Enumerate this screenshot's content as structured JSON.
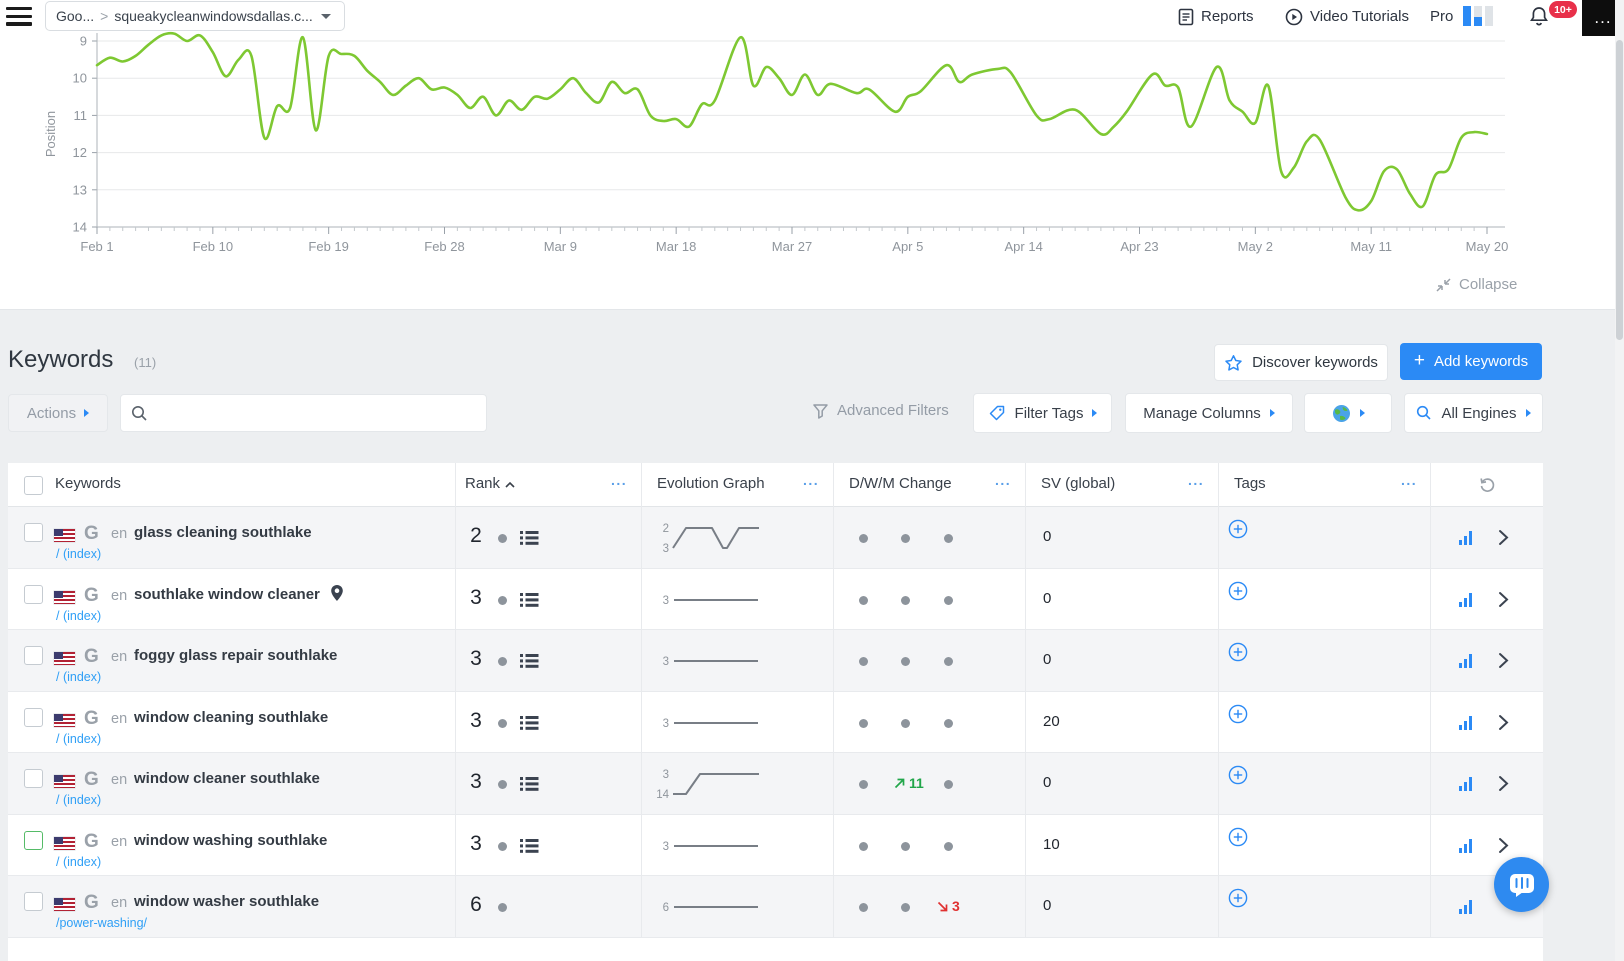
{
  "topbar": {
    "breadcrumb": {
      "group": "Goo...",
      "separator": ">",
      "domain": "squeakycleanwindowsdallas.c..."
    },
    "reports_label": "Reports",
    "video_tutorials_label": "Video Tutorials",
    "plan_label": "Pro",
    "notifications_badge": "10+",
    "menu_label": "..."
  },
  "chart": {
    "collapse_label": "Collapse"
  },
  "chart_data": {
    "type": "line",
    "title": "",
    "ylabel": "Position",
    "y_ticks": [
      9,
      10,
      11,
      12,
      13,
      14
    ],
    "y_inverted": true,
    "ylim": [
      9,
      14
    ],
    "grid": "horizontal",
    "legend": "none",
    "line_color": "#7ec832",
    "x_tick_labels": [
      "Feb 1",
      "Feb 10",
      "Feb 19",
      "Feb 28",
      "Mar 9",
      "Mar 18",
      "Mar 27",
      "Apr 5",
      "Apr 14",
      "Apr 23",
      "May 2",
      "May 11",
      "May 20"
    ],
    "x_tick_days": [
      0,
      9,
      18,
      27,
      36,
      45,
      54,
      63,
      72,
      81,
      90,
      99,
      108
    ],
    "x_range_days": [
      0,
      108
    ],
    "series": [
      {
        "name": "Position",
        "points": [
          [
            0,
            9.65
          ],
          [
            1,
            9.45
          ],
          [
            2,
            9.55
          ],
          [
            3,
            9.4
          ],
          [
            4,
            9.1
          ],
          [
            5,
            8.85
          ],
          [
            6,
            8.8
          ],
          [
            7,
            9.0
          ],
          [
            8,
            8.85
          ],
          [
            9,
            9.3
          ],
          [
            10,
            9.95
          ],
          [
            11,
            9.5
          ],
          [
            12,
            9.4
          ],
          [
            13,
            11.6
          ],
          [
            14,
            10.75
          ],
          [
            15,
            10.8
          ],
          [
            16,
            8.9
          ],
          [
            17,
            11.4
          ],
          [
            18,
            9.4
          ],
          [
            19,
            9.35
          ],
          [
            20,
            9.4
          ],
          [
            21,
            9.8
          ],
          [
            22,
            10.1
          ],
          [
            23,
            10.45
          ],
          [
            24,
            10.2
          ],
          [
            25,
            10.0
          ],
          [
            26,
            10.3
          ],
          [
            27,
            10.25
          ],
          [
            28,
            10.45
          ],
          [
            29,
            10.8
          ],
          [
            30,
            10.5
          ],
          [
            31,
            11.0
          ],
          [
            32,
            10.6
          ],
          [
            33,
            10.85
          ],
          [
            34,
            10.5
          ],
          [
            35,
            10.55
          ],
          [
            36,
            10.3
          ],
          [
            37,
            10.0
          ],
          [
            38,
            10.4
          ],
          [
            39,
            10.65
          ],
          [
            40,
            10.1
          ],
          [
            41,
            10.4
          ],
          [
            42,
            10.3
          ],
          [
            43,
            11.0
          ],
          [
            44,
            11.15
          ],
          [
            45,
            11.1
          ],
          [
            46,
            11.3
          ],
          [
            47,
            10.7
          ],
          [
            48,
            10.6
          ],
          [
            50,
            8.9
          ],
          [
            51,
            10.2
          ],
          [
            52,
            9.7
          ],
          [
            53,
            10.0
          ],
          [
            54,
            10.45
          ],
          [
            55,
            9.9
          ],
          [
            56,
            10.45
          ],
          [
            57,
            10.15
          ],
          [
            59,
            10.4
          ],
          [
            60,
            10.3
          ],
          [
            62,
            10.9
          ],
          [
            63,
            10.5
          ],
          [
            64,
            10.35
          ],
          [
            66,
            9.65
          ],
          [
            67,
            10.1
          ],
          [
            68,
            9.9
          ],
          [
            70,
            9.75
          ],
          [
            71,
            9.85
          ],
          [
            73,
            11.0
          ],
          [
            74,
            11.1
          ],
          [
            76,
            10.85
          ],
          [
            78,
            11.5
          ],
          [
            79,
            11.3
          ],
          [
            80,
            10.9
          ],
          [
            82,
            9.9
          ],
          [
            83,
            10.2
          ],
          [
            84,
            10.25
          ],
          [
            85,
            11.3
          ],
          [
            87,
            9.7
          ],
          [
            88,
            10.6
          ],
          [
            89,
            10.9
          ],
          [
            90,
            11.2
          ],
          [
            91,
            10.2
          ],
          [
            92,
            12.5
          ],
          [
            93,
            12.4
          ],
          [
            94,
            11.7
          ],
          [
            95,
            11.65
          ],
          [
            97,
            13.2
          ],
          [
            98,
            13.55
          ],
          [
            99,
            13.3
          ],
          [
            100,
            12.5
          ],
          [
            101,
            12.45
          ],
          [
            102,
            13.1
          ],
          [
            103,
            13.45
          ],
          [
            104,
            12.6
          ],
          [
            105,
            12.45
          ],
          [
            106,
            11.6
          ],
          [
            107,
            11.45
          ],
          [
            108,
            11.5
          ]
        ]
      }
    ]
  },
  "keywords_section": {
    "title": "Keywords",
    "count": "(11)",
    "discover_button": "Discover keywords",
    "add_button": "Add keywords"
  },
  "toolbar": {
    "actions_label": "Actions",
    "search_placeholder": "",
    "search_value": "",
    "advanced_filters_label": "Advanced Filters",
    "filter_tags_label": "Filter Tags",
    "manage_columns_label": "Manage Columns",
    "all_engines_label": "All Engines"
  },
  "table": {
    "headers": {
      "keywords": "Keywords",
      "rank": "Rank",
      "evolution": "Evolution Graph",
      "dwm": "D/W/M Change",
      "sv": "SV (global)",
      "tags": "Tags"
    },
    "header_ellipsis": "...",
    "rows": [
      {
        "language": "en",
        "keyword": "glass cleaning southlake",
        "url": "/ (index)",
        "has_pin": false,
        "rank": "2",
        "has_serp_icon": true,
        "graph": {
          "type": "updown",
          "top_label": "2",
          "bottom_label": "3"
        },
        "dwm": [
          {
            "t": "dot"
          },
          {
            "t": "dot"
          },
          {
            "t": "dot"
          }
        ],
        "sv": "0",
        "checkbox_highlight": false
      },
      {
        "language": "en",
        "keyword": "southlake window cleaner",
        "url": "/ (index)",
        "has_pin": true,
        "rank": "3",
        "has_serp_icon": true,
        "graph": {
          "type": "flat",
          "label": "3"
        },
        "dwm": [
          {
            "t": "dot"
          },
          {
            "t": "dot"
          },
          {
            "t": "dot"
          }
        ],
        "sv": "0",
        "checkbox_highlight": false
      },
      {
        "language": "en",
        "keyword": "foggy glass repair southlake",
        "url": "/ (index)",
        "has_pin": false,
        "rank": "3",
        "has_serp_icon": true,
        "graph": {
          "type": "flat",
          "label": "3"
        },
        "dwm": [
          {
            "t": "dot"
          },
          {
            "t": "dot"
          },
          {
            "t": "dot"
          }
        ],
        "sv": "0",
        "checkbox_highlight": false
      },
      {
        "language": "en",
        "keyword": "window cleaning southlake",
        "url": "/ (index)",
        "has_pin": false,
        "rank": "3",
        "has_serp_icon": true,
        "graph": {
          "type": "flat",
          "label": "3"
        },
        "dwm": [
          {
            "t": "dot"
          },
          {
            "t": "dot"
          },
          {
            "t": "dot"
          }
        ],
        "sv": "20",
        "checkbox_highlight": false
      },
      {
        "language": "en",
        "keyword": "window cleaner southlake",
        "url": "/ (index)",
        "has_pin": false,
        "rank": "3",
        "has_serp_icon": true,
        "graph": {
          "type": "rise",
          "top_label": "3",
          "bottom_label": "14"
        },
        "dwm": [
          {
            "t": "dot"
          },
          {
            "t": "up",
            "value": "11"
          },
          {
            "t": "dot"
          }
        ],
        "sv": "0",
        "checkbox_highlight": false
      },
      {
        "language": "en",
        "keyword": "window washing southlake",
        "url": "/ (index)",
        "has_pin": false,
        "rank": "3",
        "has_serp_icon": true,
        "graph": {
          "type": "flat",
          "label": "3"
        },
        "dwm": [
          {
            "t": "dot"
          },
          {
            "t": "dot"
          },
          {
            "t": "dot"
          }
        ],
        "sv": "10",
        "checkbox_highlight": true
      },
      {
        "language": "en",
        "keyword": "window washer southlake",
        "url": "/power-washing/",
        "has_pin": false,
        "rank": "6",
        "has_serp_icon": false,
        "graph": {
          "type": "flat",
          "label": "6"
        },
        "dwm": [
          {
            "t": "dot"
          },
          {
            "t": "dot"
          },
          {
            "t": "down",
            "value": "3"
          }
        ],
        "sv": "0",
        "checkbox_highlight": false
      }
    ]
  },
  "colors": {
    "accent_blue": "#2b8af5",
    "line_green": "#7ec832",
    "change_up_green": "#21a64a",
    "change_down_red": "#e03131",
    "badge_red": "#e8304a"
  }
}
